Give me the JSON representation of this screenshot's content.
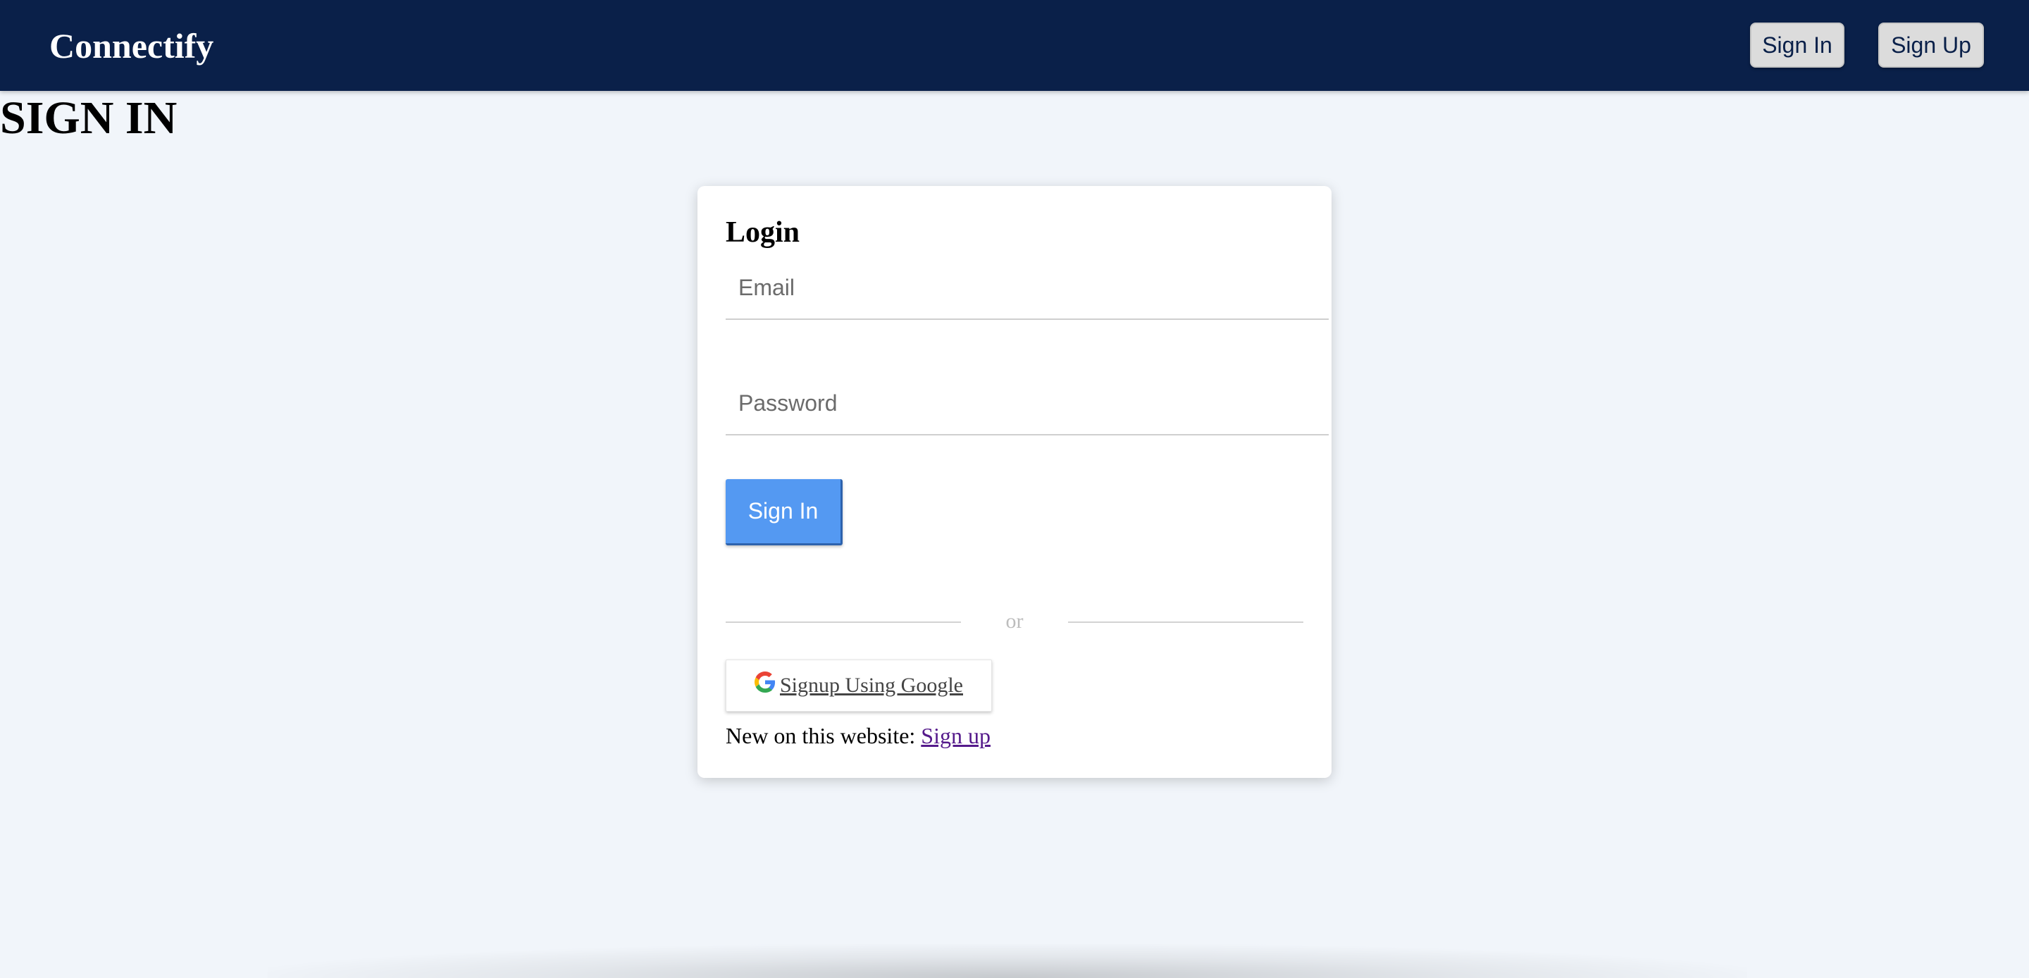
{
  "navbar": {
    "brand": "Connectify",
    "signin_label": "Sign In",
    "signup_label": "Sign Up"
  },
  "page": {
    "heading": "SIGN IN"
  },
  "login": {
    "title": "Login",
    "email_placeholder": "Email",
    "email_value": "",
    "password_placeholder": "Password",
    "password_value": "",
    "signin_label": "Sign In",
    "divider_text": "or",
    "google_label": " Signup Using Google",
    "new_user_text": "New on this website: ",
    "signup_link": "Sign up"
  },
  "colors": {
    "navbar_bg": "#0a2049",
    "page_bg": "#f1f5fa",
    "primary_button": "#5499f2",
    "link_visited": "#551a8b"
  },
  "icons": {
    "google": "google-icon"
  }
}
